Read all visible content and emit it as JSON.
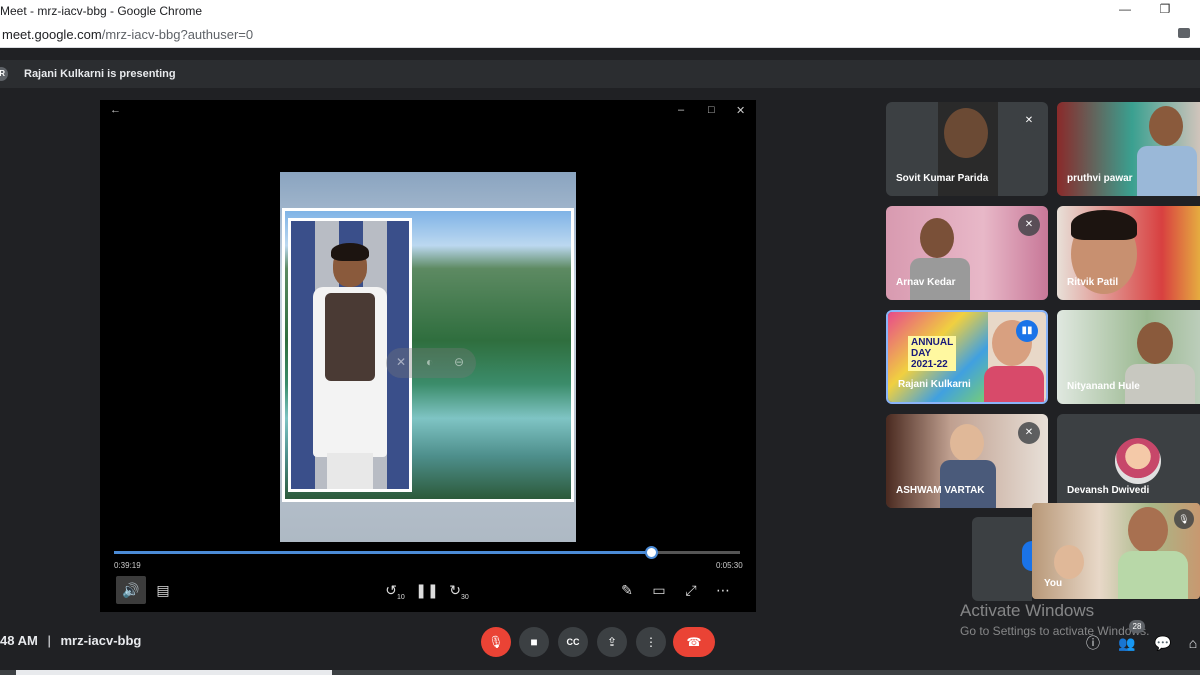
{
  "browser": {
    "window_title": "Meet - mrz-iacv-bbg - Google Chrome",
    "url_host": "meet.google.com",
    "url_path": "/mrz-iacv-bbg?authuser=0",
    "window_controls": {
      "minimize": "—",
      "restore": "❐"
    }
  },
  "presentation": {
    "avatar_initial": "R",
    "presenter_text": "Rajani Kulkarni is presenting"
  },
  "player": {
    "back_icon": "←",
    "window_controls": [
      "–",
      "□",
      "✕"
    ],
    "current_time": "0:39:19",
    "total_time": "0:05:30",
    "progress": 0.86,
    "buttons": {
      "volume": "🔊",
      "captions": "▤",
      "rewind": "↺",
      "rewind_label": "10",
      "pause": "❚❚",
      "forward": "↻",
      "forward_label": "30",
      "pen": "✎",
      "pip": "▭",
      "fullscreen": "⤢",
      "more": "⋯"
    }
  },
  "participants": [
    {
      "name": "Sovit Kumar Parida",
      "muted": true
    },
    {
      "name": "pruthvi pawar",
      "muted": false
    },
    {
      "name": "Arnav Kedar",
      "muted": true
    },
    {
      "name": "Ritvik Patil",
      "muted": false
    },
    {
      "name": "Rajani Kulkarni",
      "muted": false,
      "speaking": true,
      "slide_text": [
        "ANNUAL",
        "DAY",
        "2021-22"
      ]
    },
    {
      "name": "Nityanand Hule",
      "muted": false
    },
    {
      "name": "ASHWAM VARTAK",
      "muted": true
    },
    {
      "name": "Devansh Dwivedi",
      "muted": false
    }
  ],
  "self_view": {
    "name": "You",
    "mic_icon": "🎙"
  },
  "watermark": {
    "title": "Activate Windows",
    "subtitle": "Go to Settings to activate Windows."
  },
  "meeting": {
    "time": "48 AM",
    "separator": "|",
    "code": "mrz-iacv-bbg"
  },
  "controls": {
    "mic": "🎙",
    "camera": "■",
    "captions": "CC",
    "present": "⇪",
    "more": "⋮",
    "end_call": "☎",
    "info": "ⓘ",
    "people": "👥",
    "people_count": "28",
    "chat": "💬",
    "activities": "⌂"
  },
  "colors": {
    "meet_background": "#202124",
    "tile_background": "#3c4043",
    "accent_blue": "#1a73e8",
    "danger_red": "#ea4335",
    "progress_blue": "#4b8bd6"
  }
}
